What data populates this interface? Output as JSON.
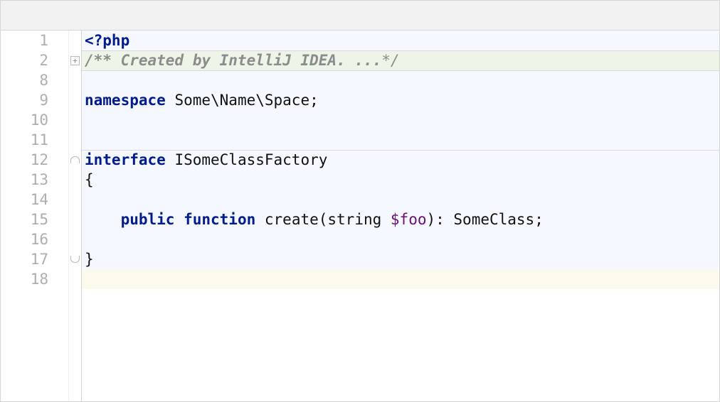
{
  "editor": {
    "lines": [
      {
        "num": "1",
        "bg": "bg-default",
        "fold": "",
        "tokens": [
          {
            "cls": "kw",
            "t": "<?php"
          }
        ]
      },
      {
        "num": "2",
        "bg": "bg-green",
        "fold": "plus",
        "tokens": [
          {
            "cls": "cmt",
            "t": "/** Created by IntelliJ IDEA. ..."
          },
          {
            "cls": "cmt-plain",
            "t": "*/"
          }
        ]
      },
      {
        "num": "8",
        "bg": "bg-default",
        "fold": "",
        "tokens": []
      },
      {
        "num": "9",
        "bg": "bg-default",
        "fold": "",
        "tokens": [
          {
            "cls": "kw",
            "t": "namespace"
          },
          {
            "cls": "txt",
            "t": " Some\\Name\\Space;"
          }
        ]
      },
      {
        "num": "10",
        "bg": "bg-default",
        "fold": "",
        "tokens": []
      },
      {
        "num": "11",
        "bg": "bg-default",
        "fold": "",
        "tokens": []
      },
      {
        "num": "12",
        "bg": "bg-default",
        "fold": "cap",
        "tokens": [
          {
            "cls": "kw",
            "t": "interface"
          },
          {
            "cls": "txt",
            "t": " ISomeClassFactory"
          }
        ]
      },
      {
        "num": "13",
        "bg": "bg-default",
        "fold": "",
        "tokens": [
          {
            "cls": "txt",
            "t": "{"
          }
        ]
      },
      {
        "num": "14",
        "bg": "bg-default",
        "fold": "",
        "tokens": []
      },
      {
        "num": "15",
        "bg": "bg-default",
        "fold": "",
        "tokens": [
          {
            "cls": "txt",
            "t": "    "
          },
          {
            "cls": "kw",
            "t": "public"
          },
          {
            "cls": "txt",
            "t": " "
          },
          {
            "cls": "kw",
            "t": "function"
          },
          {
            "cls": "txt",
            "t": " create(string "
          },
          {
            "cls": "var",
            "t": "$foo"
          },
          {
            "cls": "txt",
            "t": "): SomeClass;"
          }
        ]
      },
      {
        "num": "16",
        "bg": "bg-default",
        "fold": "",
        "tokens": []
      },
      {
        "num": "17",
        "bg": "bg-default",
        "fold": "end",
        "tokens": [
          {
            "cls": "txt",
            "t": "}"
          }
        ]
      },
      {
        "num": "18",
        "bg": "bg-yellow",
        "fold": "",
        "tokens": []
      }
    ],
    "separators_after": [
      0,
      1,
      5
    ],
    "fold_glyphs": {
      "plus": "+",
      "minus": "−"
    }
  }
}
